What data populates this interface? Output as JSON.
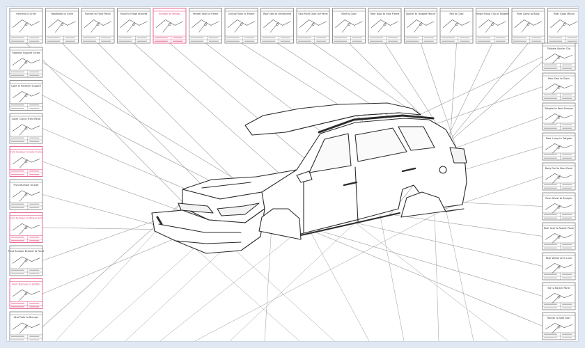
{
  "diagram": {
    "colors": {
      "background": "#dfe8f3",
      "sheet": "#ffffff",
      "line": "#9a9a9a",
      "card_border": "#777777",
      "highlight": "#e0457a",
      "car_stroke": "#2b2b2b"
    },
    "top_callouts": [
      {
        "label": "Harness to Grille",
        "hl": false
      },
      {
        "label": "Headlamp to Grille",
        "hl": false
      },
      {
        "label": "Bonnet to Front Panel",
        "hl": false
      },
      {
        "label": "Hood to Hinge Bracket",
        "hl": false
      },
      {
        "label": "Bumper to Fender",
        "hl": true
      },
      {
        "label": "Fender Seal to Frame",
        "hl": false
      },
      {
        "label": "Sunroof Seal to Frame",
        "hl": false
      },
      {
        "label": "Roof Seal to Windshield",
        "hl": false
      },
      {
        "label": "Seal Front Door to Frame",
        "hl": false
      },
      {
        "label": "Roof to Cowl",
        "hl": false
      },
      {
        "label": "Rear Door to Side Frame",
        "hl": false
      },
      {
        "label": "Spoiler to Tailgate Mount",
        "hl": false
      },
      {
        "label": "Rail to Cowl",
        "hl": false
      },
      {
        "label": "Hinge Fixing Clip to Tailgate",
        "hl": false
      },
      {
        "label": "Rear Lamp to Body",
        "hl": false
      },
      {
        "label": "Rear Glass Mount",
        "hl": false
      }
    ],
    "left_callouts": [
      {
        "label": "Radiator Support Screw",
        "hl": false
      },
      {
        "label": "Light to Radiator Support",
        "hl": false
      },
      {
        "label": "Cover Clip to Front Panel",
        "hl": false
      },
      {
        "label": "Front Bumper to Side Frame",
        "hl": true
      },
      {
        "label": "Front Bumper to Side",
        "hl": false
      },
      {
        "label": "Front Bumper to Wheel Arch",
        "hl": true
      },
      {
        "label": "Front Bumper Bracket to Panel",
        "hl": false
      },
      {
        "label": "Front Bumper to Splitter",
        "hl": true
      },
      {
        "label": "Skid Plate to Bumper",
        "hl": false
      }
    ],
    "right_callouts": [
      {
        "label": "Tailgate Spoiler Clip",
        "hl": false
      },
      {
        "label": "Rear Seal to Glass",
        "hl": false
      },
      {
        "label": "Tailgate to Rear Bumper",
        "hl": false
      },
      {
        "label": "Rear Lamp to Tailgate",
        "hl": false
      },
      {
        "label": "Body Rail to Rear Panel",
        "hl": false
      },
      {
        "label": "Rear Wheel to Bumper",
        "hl": false
      },
      {
        "label": "Rear Seal to Rocker Panel",
        "hl": false
      },
      {
        "label": "Rear Wheel Arch Liner",
        "hl": false
      },
      {
        "label": "Sill to Rocker Panel",
        "hl": false
      },
      {
        "label": "Rocker to Side Skirt",
        "hl": false
      }
    ]
  }
}
